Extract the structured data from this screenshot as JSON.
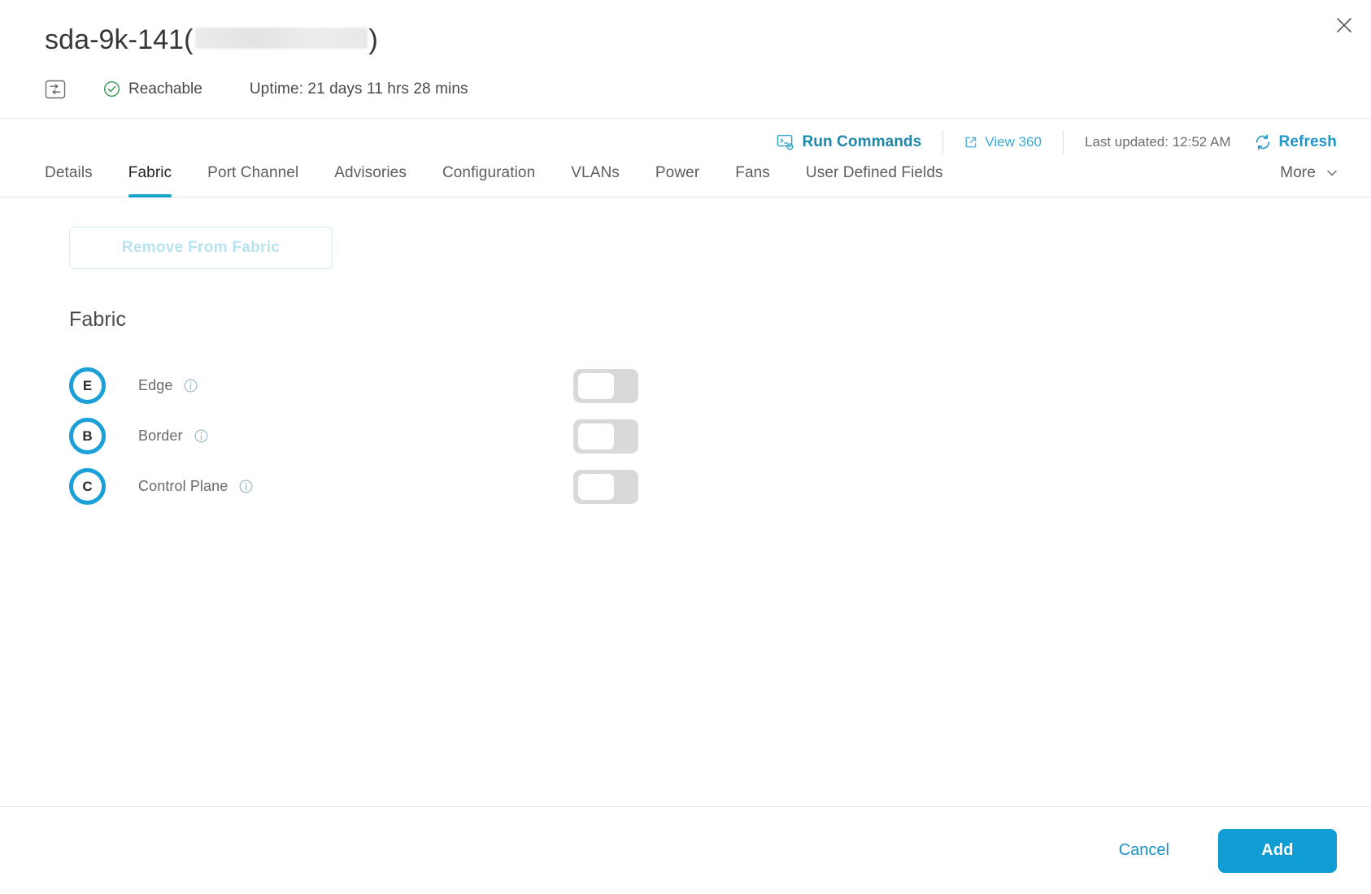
{
  "header": {
    "device_name": "sda-9k-141",
    "paren_open": "(",
    "paren_close": ")",
    "redacted_label": "redacted-ip-address",
    "reachability": "Reachable",
    "uptime": "Uptime: 21 days 11 hrs 28 mins",
    "device_icon": "switch-icon",
    "reachable_icon": "check-circle-icon",
    "close_icon": "close-icon",
    "status_color": "#3a9a52"
  },
  "toolbar": {
    "run_commands": "Run Commands",
    "run_commands_icon": "terminal-gear-icon",
    "view_360": "View 360",
    "view_360_icon": "external-link-icon",
    "last_updated": "Last updated: 12:52 AM",
    "refresh": "Refresh",
    "refresh_icon": "refresh-icon",
    "accent_color": "#1f87a8"
  },
  "tabs": [
    {
      "label": "Details",
      "active": false
    },
    {
      "label": "Fabric",
      "active": true
    },
    {
      "label": "Port Channel",
      "active": false
    },
    {
      "label": "Advisories",
      "active": false
    },
    {
      "label": "Configuration",
      "active": false
    },
    {
      "label": "VLANs",
      "active": false
    },
    {
      "label": "Power",
      "active": false
    },
    {
      "label": "Fans",
      "active": false
    },
    {
      "label": "User Defined Fields",
      "active": false
    },
    {
      "label": "More",
      "active": false
    }
  ],
  "tab_accent_color": "#16a4c8",
  "main": {
    "remove_button": "Remove From Fabric",
    "remove_button_disabled": true,
    "section_title": "Fabric",
    "roles": [
      {
        "badge": "E",
        "label": "Edge",
        "info_icon": "info-icon",
        "toggle_on": false
      },
      {
        "badge": "B",
        "label": "Border",
        "info_icon": "info-icon",
        "toggle_on": false
      },
      {
        "badge": "C",
        "label": "Control Plane",
        "info_icon": "info-icon",
        "toggle_on": false
      }
    ],
    "badge_color": "#1ba0d7"
  },
  "footer": {
    "cancel": "Cancel",
    "add": "Add",
    "add_color": "#0f9dd4"
  }
}
